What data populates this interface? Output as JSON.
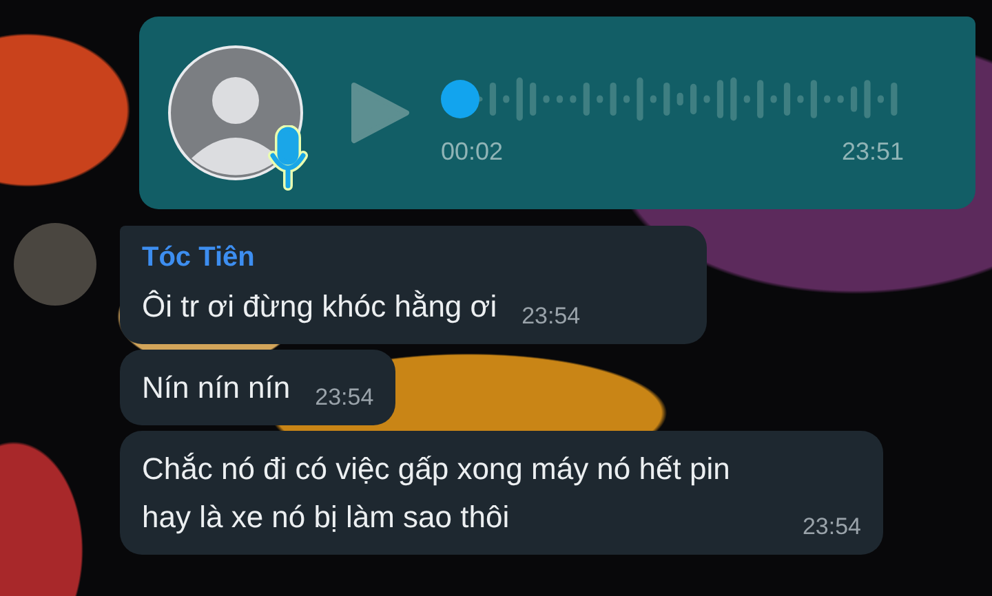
{
  "voice_message": {
    "elapsed": "00:02",
    "time": "23:51"
  },
  "incoming": {
    "sender": "Tóc Tiên",
    "messages": [
      {
        "text": "Ôi tr ơi đừng khóc hằng ơi",
        "time": "23:54"
      },
      {
        "text": "Nín nín nín",
        "time": "23:54"
      },
      {
        "text": "Chắc nó đi có việc gấp xong máy nó hết pin hay là xe nó bị làm sao thôi",
        "time": "23:54"
      }
    ]
  }
}
